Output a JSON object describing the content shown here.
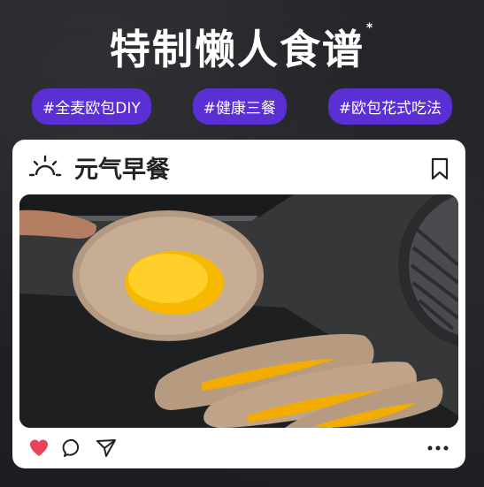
{
  "header": {
    "title": "特制懒人食谱",
    "title_mark": "*"
  },
  "tags": [
    {
      "label": "#全麦欧包DIY"
    },
    {
      "label": "#健康三餐"
    },
    {
      "label": "#欧包花式吃法"
    }
  ],
  "card": {
    "title": "元气早餐",
    "icons": {
      "title_icon": "sunrise-icon",
      "bookmark": "bookmark-icon",
      "like": "heart-icon",
      "comment": "comment-icon",
      "share": "send-icon",
      "more": "more-icon"
    },
    "photo": {
      "subject": "photo of whole wheat bread with egg yolk filling"
    }
  },
  "colors": {
    "tag_bg": "#5a2fd3",
    "like": "#e8435a",
    "background": "#222326"
  }
}
